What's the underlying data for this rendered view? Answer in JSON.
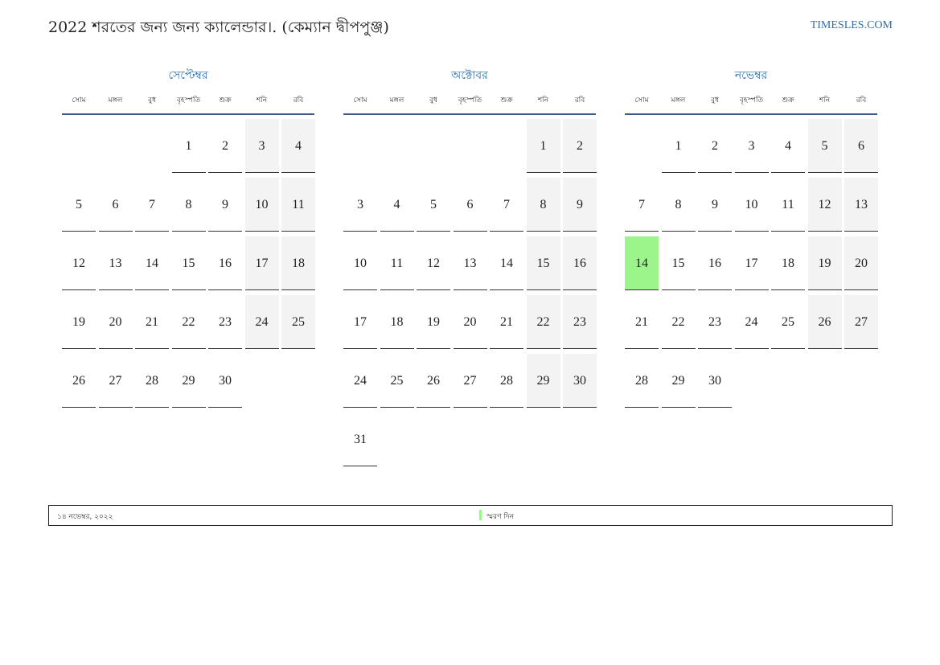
{
  "header": {
    "title": "2022 শরতের জন্য জন্য ক্যালেন্ডার।. (কেম্যান দ্বীপপুঞ্জ)",
    "site": "TIMESLES.COM"
  },
  "weekday_labels": [
    "সোম",
    "মঙ্গল",
    "বুধ",
    "বৃহস্পতি",
    "শুক্র",
    "শনি",
    "রবি"
  ],
  "months": [
    {
      "name": "সেপ্টেম্বর",
      "weeks": [
        [
          "",
          "",
          "",
          "1",
          "2",
          "3",
          "4"
        ],
        [
          "5",
          "6",
          "7",
          "8",
          "9",
          "10",
          "11"
        ],
        [
          "12",
          "13",
          "14",
          "15",
          "16",
          "17",
          "18"
        ],
        [
          "19",
          "20",
          "21",
          "22",
          "23",
          "24",
          "25"
        ],
        [
          "26",
          "27",
          "28",
          "29",
          "30",
          "",
          ""
        ]
      ]
    },
    {
      "name": "অক্টোবর",
      "weeks": [
        [
          "",
          "",
          "",
          "",
          "",
          "1",
          "2"
        ],
        [
          "3",
          "4",
          "5",
          "6",
          "7",
          "8",
          "9"
        ],
        [
          "10",
          "11",
          "12",
          "13",
          "14",
          "15",
          "16"
        ],
        [
          "17",
          "18",
          "19",
          "20",
          "21",
          "22",
          "23"
        ],
        [
          "24",
          "25",
          "26",
          "27",
          "28",
          "29",
          "30"
        ],
        [
          "31",
          "",
          "",
          "",
          "",
          "",
          ""
        ]
      ]
    },
    {
      "name": "নভেম্বর",
      "weeks": [
        [
          "",
          "1",
          "2",
          "3",
          "4",
          "5",
          "6"
        ],
        [
          "7",
          "8",
          "9",
          "10",
          "11",
          "12",
          "13"
        ],
        [
          "14",
          "15",
          "16",
          "17",
          "18",
          "19",
          "20"
        ],
        [
          "21",
          "22",
          "23",
          "24",
          "25",
          "26",
          "27"
        ],
        [
          "28",
          "29",
          "30",
          "",
          "",
          "",
          ""
        ]
      ],
      "highlighted_day": "14"
    }
  ],
  "footer": {
    "date_text": "১৪ নভেম্বর, ২০২২",
    "legend_label": "স্মরণ দিন",
    "legend_color": "#9cf58a"
  },
  "colors": {
    "accent": "#2f6fad",
    "weekend_bg": "#f3f3f3",
    "highlight": "#9cf58a"
  }
}
